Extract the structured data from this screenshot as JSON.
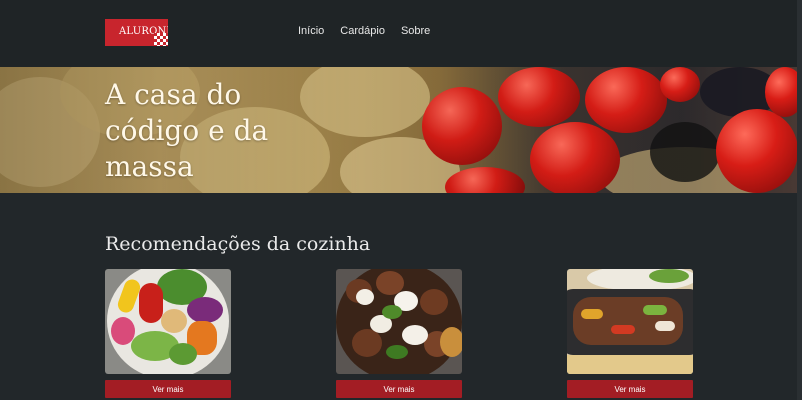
{
  "header": {
    "logo_text": "ALURONI",
    "nav": [
      "Início",
      "Cardápio",
      "Sobre"
    ]
  },
  "hero": {
    "title": "A casa do código e da massa"
  },
  "recommendations": {
    "title": "Recomendações da cozinha",
    "cards": [
      {
        "image": "salad-bowl-image",
        "button_label": "Ver mais"
      },
      {
        "image": "meatballs-dish-image",
        "button_label": "Ver mais"
      },
      {
        "image": "beef-fajita-image",
        "button_label": "Ver mais"
      }
    ]
  },
  "colors": {
    "background": "#22272a",
    "header": "#1f2426",
    "brand_red": "#c8252d",
    "button_red": "#a31d24"
  }
}
